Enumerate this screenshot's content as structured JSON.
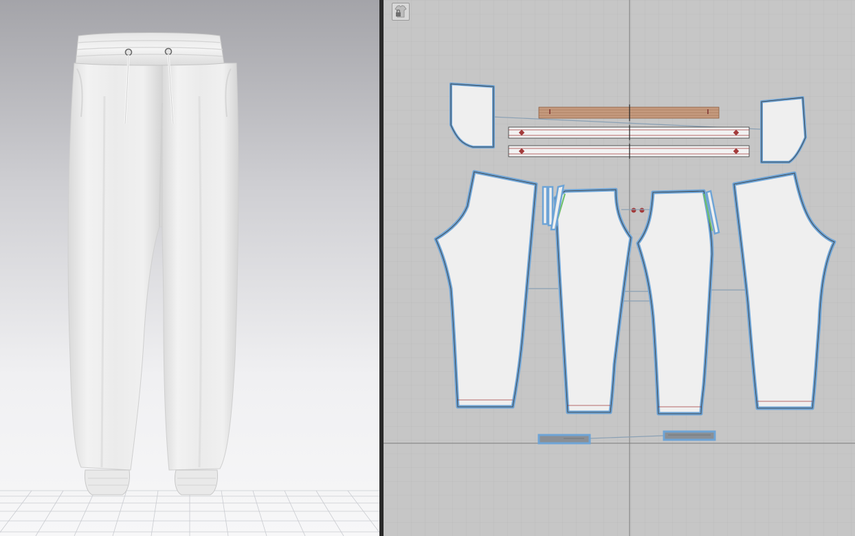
{
  "app": {
    "views": [
      {
        "id": "3d-view",
        "content": "3d-garment-jogger-pants"
      },
      {
        "id": "2d-view",
        "content": "2d-pattern-layout"
      }
    ]
  },
  "toolbar_2d": {
    "tools": [
      {
        "icon": "lock-shirt-icon"
      }
    ]
  },
  "colors": {
    "background_3d_top": "#a4a4a9",
    "background_3d_bottom": "#f5f5f7",
    "grid_2d_background": "#c6c6c6",
    "pattern_fill": "#efefef",
    "pattern_outline": "#6ea4d6",
    "trim_orange": "#c59a7e",
    "trim_gray": "#8a8f95",
    "stitch_green": "#6fbf6a",
    "notch_red": "#a33a3a"
  },
  "pattern_pieces": [
    {
      "name": "pocket-facing-left"
    },
    {
      "name": "pocket-facing-right"
    },
    {
      "name": "waistband"
    },
    {
      "name": "drawstring-casing-1"
    },
    {
      "name": "drawstring-casing-2"
    },
    {
      "name": "back-leg-left"
    },
    {
      "name": "front-leg-left"
    },
    {
      "name": "front-leg-right"
    },
    {
      "name": "back-leg-right"
    },
    {
      "name": "cuff-left"
    },
    {
      "name": "cuff-right"
    }
  ]
}
